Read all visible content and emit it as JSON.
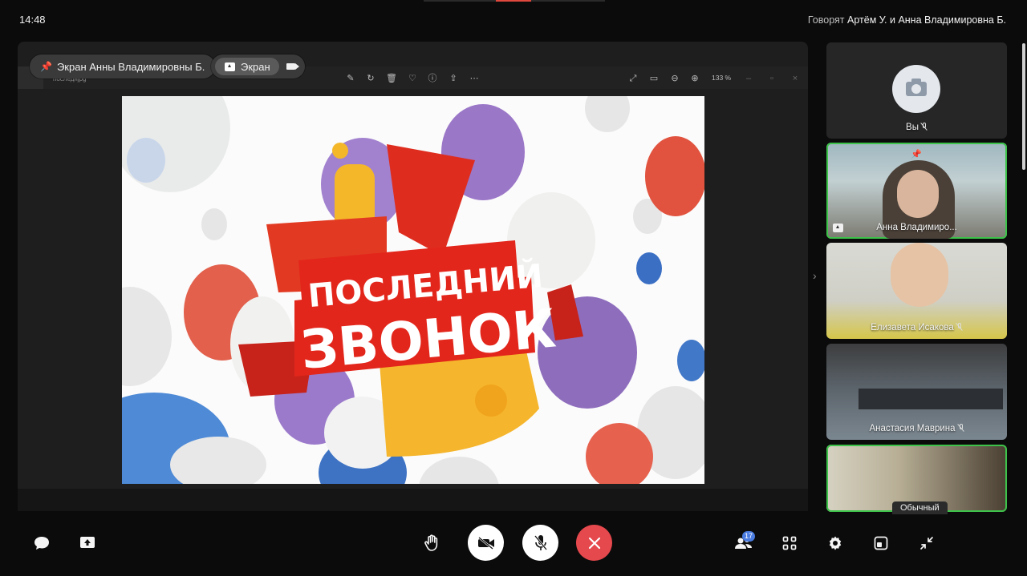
{
  "status": {
    "time": "14:48",
    "speaking_prefix": "Говорят",
    "speaking_names": "Артём У. и Анна Владимировна Б."
  },
  "stage": {
    "pinned_label": "Экран Анны Владимировны Б.",
    "screen_tab_label": "Экран",
    "viewer": {
      "file_name": "последнjpg",
      "zoom": "133 %"
    },
    "slide": {
      "line1": "ПОСЛЕДНИЙ",
      "line2": "ЗВОНОК"
    }
  },
  "participants": [
    {
      "name": "Вы",
      "muted": true,
      "active": false
    },
    {
      "name": "Анна Владимиро...",
      "muted": false,
      "active": true,
      "sharing": true
    },
    {
      "name": "Елизавета Исакова",
      "muted": true,
      "active": false
    },
    {
      "name": "Анастасия Маврина",
      "muted": true,
      "active": false
    },
    {
      "name": "",
      "muted": false,
      "active": true
    }
  ],
  "view_mode_label": "Обычный",
  "toolbar": {
    "participants_count": "17"
  },
  "colors": {
    "accent_active": "#3dc24a",
    "end_call": "#e5484d",
    "badge": "#4a7be0"
  }
}
